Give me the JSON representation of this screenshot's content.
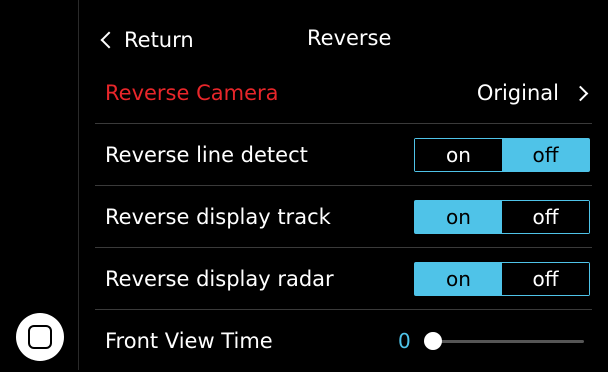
{
  "header": {
    "back_label": "Return",
    "title": "Reverse"
  },
  "settings": {
    "reverse_camera": {
      "label": "Reverse Camera",
      "value": "Original",
      "label_color": "#e8262a"
    },
    "line_detect": {
      "label": "Reverse line detect",
      "on_label": "on",
      "off_label": "off",
      "state": "off"
    },
    "display_track": {
      "label": "Reverse display track",
      "on_label": "on",
      "off_label": "off",
      "state": "on"
    },
    "display_radar": {
      "label": "Reverse display radar",
      "on_label": "on",
      "off_label": "off",
      "state": "on"
    },
    "front_view_time": {
      "label": "Front View Time",
      "value": "0"
    }
  },
  "colors": {
    "accent": "#4fc3e8",
    "highlight": "#e8262a",
    "background": "#000000"
  },
  "icons": {
    "back": "chevron-left-icon",
    "next": "chevron-right-icon",
    "home": "home-icon"
  }
}
